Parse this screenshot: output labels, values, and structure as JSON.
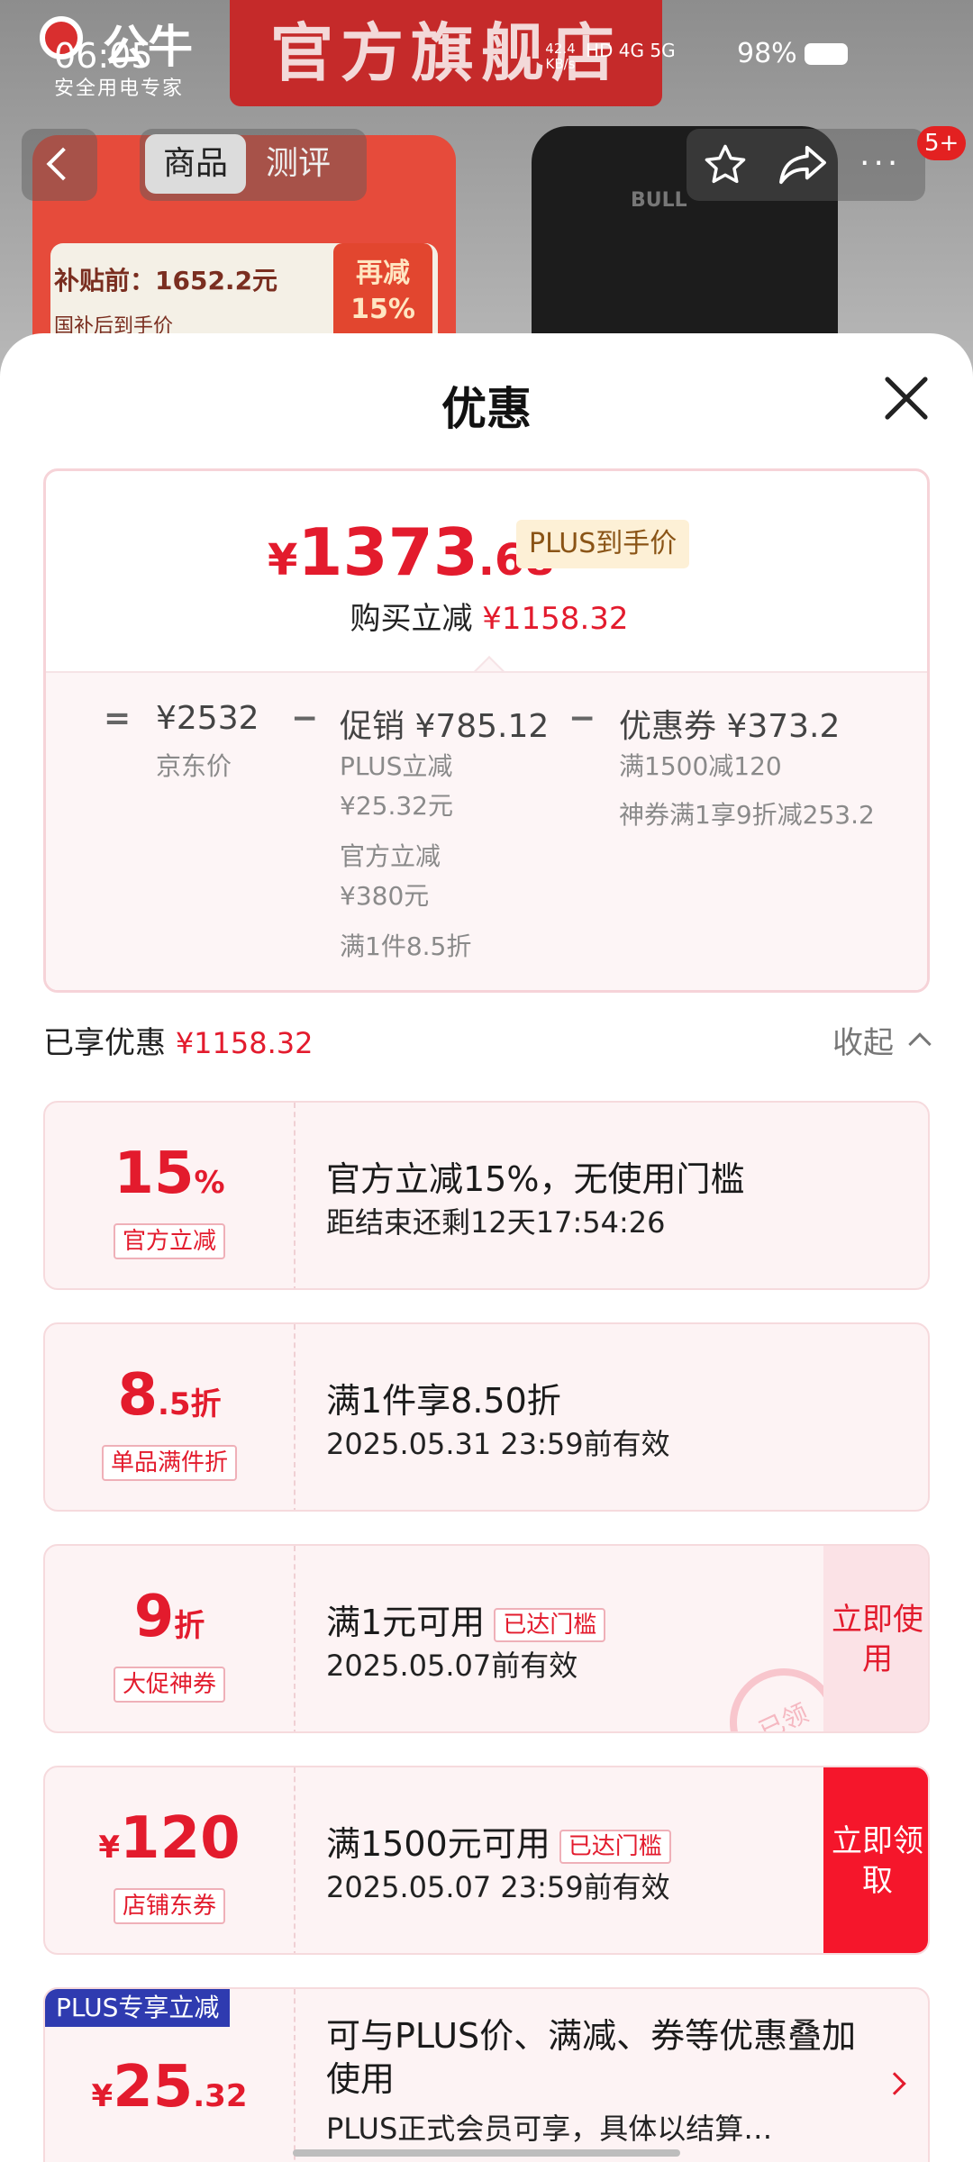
{
  "status_bar": {
    "time": "06:05",
    "net_speed_value": "42.4",
    "net_speed_unit": "KB/s",
    "network_icons": "HD 4G 5G",
    "battery": "98%"
  },
  "background": {
    "brand_name": "公牛",
    "brand_slogan": "安全用电专家",
    "banner": "官方旗舰店",
    "promo_subsidy": "补贴前：1652.2元",
    "promo_after": "国补后到手价",
    "promo_tag_line1": "再减",
    "promo_tag_line2": "15%",
    "product_brand": "BULL"
  },
  "nav": {
    "tab_products": "商品",
    "tab_reviews": "测评",
    "more": "···",
    "badge": "5+"
  },
  "sheet": {
    "title": "优惠",
    "price": {
      "currency": "¥",
      "integer": "1373",
      "decimal": ".68",
      "plus_tag": "PLUS到手价",
      "save_label": "购买立减",
      "save_value": "¥1158.32"
    },
    "breakdown": {
      "op_equal": "=",
      "jd_price": "¥2532",
      "jd_label": "京东价",
      "op_minus1": "−",
      "promo_label": "促销 ¥785.12",
      "promo_items": [
        "PLUS立减",
        "¥25.32元",
        "官方立减",
        "¥380元",
        "满1件8.5折"
      ],
      "op_minus2": "−",
      "coupon_label": "优惠券 ¥373.2",
      "coupon_items": [
        "满1500减120",
        "神券满1享9折减253.2"
      ]
    },
    "enjoyed_label": "已享优惠",
    "enjoyed_value": "¥1158.32",
    "collapse_label": "收起",
    "coupons": [
      {
        "value_big": "15",
        "value_small": "%",
        "label": "官方立减",
        "title": "官方立减15%，无使用门槛",
        "desc": "距结束还剩12天17:54:26"
      },
      {
        "value_big": "8",
        "value_small": ".5折",
        "label": "单品满件折",
        "title": "满1件享8.50折",
        "desc": "2025.05.31 23:59前有效"
      },
      {
        "value_big": "9",
        "value_small": "折",
        "label": "大促神券",
        "title": "满1元可用",
        "tag": "已达门槛",
        "desc": "2025.05.07前有效",
        "action": "立即使用",
        "stamp": "已领"
      },
      {
        "value_prefix": "¥",
        "value_big": "120",
        "label": "店铺东券",
        "title": "满1500元可用",
        "tag": "已达门槛",
        "desc": "2025.05.07 23:59前有效",
        "action": "立即领取"
      },
      {
        "ribbon": "PLUS专享立减",
        "value_prefix": "¥",
        "value_big": "25",
        "value_small": ".32",
        "title": "可与PLUS价、满减、券等优惠叠加使用",
        "desc": "PLUS正式会员可享，具体以结算…"
      }
    ]
  },
  "colors": {
    "accent_red": "#e31b2d",
    "plus_blue": "#2f3bb0",
    "plus_gold_bg": "#fdf0d6"
  }
}
